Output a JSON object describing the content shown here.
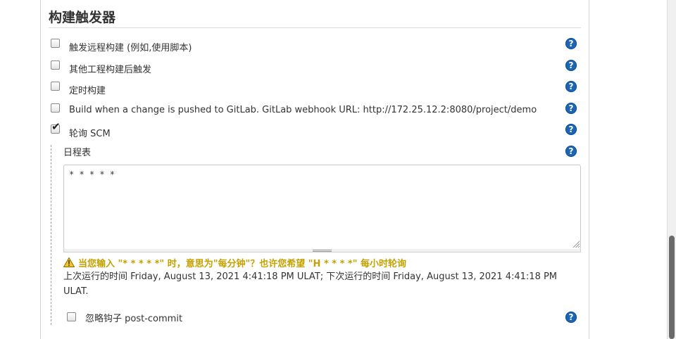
{
  "section": {
    "title": "构建触发器"
  },
  "triggers": [
    {
      "label": "触发远程构建 (例如,使用脚本)",
      "checked": false,
      "help": "?"
    },
    {
      "label": "其他工程构建后触发",
      "checked": false,
      "help": "?"
    },
    {
      "label": "定时构建",
      "checked": false,
      "help": "?"
    },
    {
      "label": "Build when a change is pushed to GitLab. GitLab webhook URL: http://172.25.12.2:8080/project/demo",
      "checked": false,
      "help": "?"
    },
    {
      "label": "轮询 SCM",
      "checked": true,
      "help": "?"
    }
  ],
  "poll_scm": {
    "schedule_label": "日程表",
    "schedule_value": "* * * * *",
    "help": "?",
    "warning": "当您输入 \"* * * * *\" 时，意思为\"每分钟\"？也许您希望 \"H * * * *\" 每小时轮询",
    "info": "上次运行的时间 Friday, August 13, 2021 4:41:18 PM ULAT; 下次运行的时间 Friday, August 13, 2021 4:41:18 PM ULAT.",
    "ignore_hooks_label": "忽略钩子 post-commit",
    "ignore_hooks_checked": false,
    "ignore_hooks_help": "?"
  },
  "colors": {
    "help_icon": "#1a66b5",
    "warning_text": "#c4a000"
  },
  "icons": {
    "help": "question-circle-icon",
    "warning": "warning-triangle-icon",
    "check": "checkmark-icon"
  }
}
